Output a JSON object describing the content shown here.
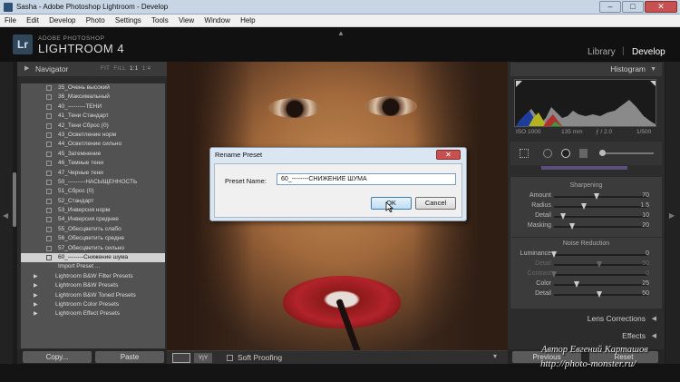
{
  "window": {
    "title": "Sasha - Adobe Photoshop Lightroom - Develop",
    "controls": {
      "minimize": "–",
      "maximize": "□",
      "close": "✕"
    }
  },
  "menu": [
    "File",
    "Edit",
    "Develop",
    "Photo",
    "Settings",
    "Tools",
    "View",
    "Window",
    "Help"
  ],
  "identity": {
    "badge": "Lr",
    "line1": "ADOBE PHOTOSHOP",
    "line2": "LIGHTROOM 4",
    "modules": {
      "library": "Library",
      "separator": "|",
      "develop": "Develop"
    }
  },
  "navigator": {
    "title": "Navigator",
    "zoom": {
      "fit": "FIT",
      "fill": "FILL",
      "one": "1:1",
      "ratio": "1:4"
    }
  },
  "presets": [
    "35_Очень высокий",
    "36_Максимальный",
    "40_---------ТЕНИ",
    "41_Тени Стандарт",
    "42_Тени Сброс (0)",
    "43_Осветление норм",
    "44_Осветление сильно",
    "45_Затемнение",
    "46_Темные тени",
    "47_Черные тени",
    "50_---------НАСЫЩЕННОСТЬ",
    "51_Сброс (0)",
    "52_Стандарт",
    "53_Инверсия норм",
    "54_Инверсия среднее",
    "55_Обесцветить слабо",
    "56_Обесцветить средне",
    "57_Обесцветить сильно",
    "60_--------Снижение шума"
  ],
  "import_preset": "Import Preset ...",
  "preset_groups": [
    "Lightroom B&W Filter Presets",
    "Lightroom B&W Presets",
    "Lightroom B&W Toned Presets",
    "Lightroom Color Presets",
    "Lightroom Effect Presets"
  ],
  "left_buttons": {
    "copy": "Copy...",
    "paste": "Paste"
  },
  "toolbar": {
    "yy": "Y|Y",
    "soft_proofing": "Soft Proofing",
    "caret": "▾"
  },
  "histogram": {
    "title": "Histogram",
    "iso": "ISO 1000",
    "focal": "135 mm",
    "aperture": "ƒ / 2.0",
    "shutter": "1/500"
  },
  "detail": {
    "sharpening": {
      "title": "Sharpening",
      "sliders": [
        {
          "label": "Amount",
          "value": "70",
          "pos": 0.47,
          "enabled": true
        },
        {
          "label": "Radius",
          "value": "1.5",
          "pos": 0.33,
          "enabled": true
        },
        {
          "label": "Detail",
          "value": "10",
          "pos": 0.1,
          "enabled": true
        },
        {
          "label": "Masking",
          "value": "20",
          "pos": 0.2,
          "enabled": true
        }
      ]
    },
    "noise": {
      "title": "Noise Reduction",
      "sliders": [
        {
          "label": "Luminance",
          "value": "0",
          "pos": 0.0,
          "enabled": true
        },
        {
          "label": "Detail",
          "value": "50",
          "pos": 0.5,
          "enabled": false
        },
        {
          "label": "Contrast",
          "value": "0",
          "pos": 0.0,
          "enabled": false
        },
        {
          "label": "Color",
          "value": "25",
          "pos": 0.25,
          "enabled": true
        },
        {
          "label": "Detail",
          "value": "50",
          "pos": 0.5,
          "enabled": true
        }
      ]
    }
  },
  "panels": {
    "lens": "Lens Corrections",
    "effects": "Effects"
  },
  "right_buttons": {
    "previous": "Previous",
    "reset": "Reset"
  },
  "dialog": {
    "title": "Rename Preset",
    "close": "✕",
    "label": "Preset Name:",
    "value": "60_--------СНИЖЕНИЕ ШУМА",
    "ok": "OK",
    "cancel": "Cancel"
  },
  "watermark": {
    "line1": "Автор Евгений Карташов",
    "line2": "http://photo-monster.ru/"
  },
  "colors": {
    "selected_row": "#d1d1d1",
    "dialog_bg": "#dbe6f3",
    "accent": "#3c7fb1"
  }
}
